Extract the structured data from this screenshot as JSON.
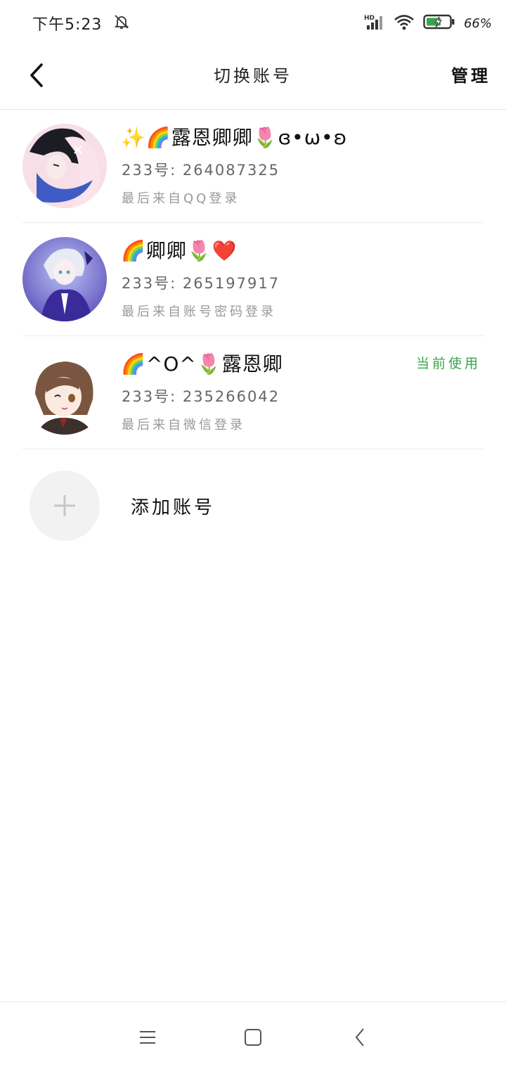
{
  "status_bar": {
    "time": "下午5:23",
    "network": "HD",
    "battery": "66%"
  },
  "header": {
    "title": "切换账号",
    "manage_label": "管理"
  },
  "accounts": [
    {
      "name": "✨🌈露恩卿卿🌷ɞ•ω•ʚ",
      "id_line": "233号: 264087325",
      "login_line": "最后来自QQ登录",
      "current": ""
    },
    {
      "name": "🌈卿卿🌷❤️",
      "id_line": "233号: 265197917",
      "login_line": "最后来自账号密码登录",
      "current": ""
    },
    {
      "name": "🌈^O^🌷露恩卿",
      "id_line": "233号: 235266042",
      "login_line": "最后来自微信登录",
      "current": "当前使用"
    }
  ],
  "add_account_label": "添加账号",
  "colors": {
    "current_badge": "#3aa64a",
    "divider": "#ececec",
    "add_circle_bg": "#f2f2f2"
  }
}
